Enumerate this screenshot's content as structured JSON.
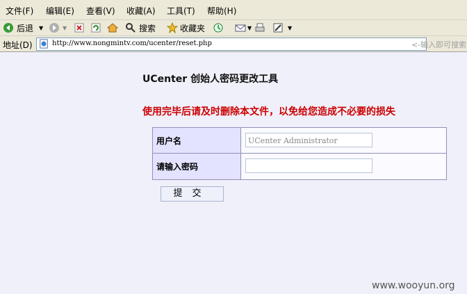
{
  "menubar": {
    "items": [
      "文件(F)",
      "编辑(E)",
      "查看(V)",
      "收藏(A)",
      "工具(T)",
      "帮助(H)"
    ]
  },
  "toolbar": {
    "back_label": "后退",
    "search_label": "搜索",
    "favorites_label": "收藏夹"
  },
  "address": {
    "label": "地址(D)",
    "url": "http://www.nongmintv.com/ucenter/reset.php",
    "search_placeholder": "<-输入即可搜索"
  },
  "page": {
    "title": "UCenter 创始人密码更改工具",
    "warning": "使用完毕后请及时删除本文件，以免给您造成不必要的损失",
    "username_label": "用户名",
    "username_value": "UCenter Administrator",
    "password_label": "请输入密码",
    "password_value": "",
    "submit_label": "提交"
  },
  "watermark": "www.wooyun.org",
  "colors": {
    "warning": "#cc0000",
    "label_bg": "#e3e3ff",
    "page_bg": "#f0f0fa"
  }
}
